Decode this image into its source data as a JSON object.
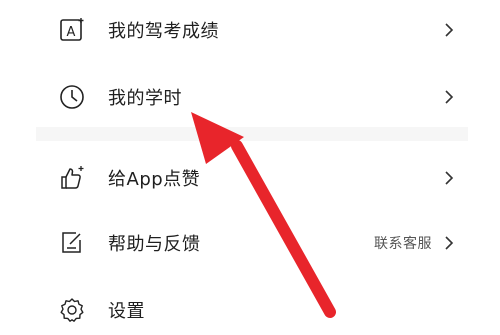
{
  "menu": {
    "items": [
      {
        "label": "我的驾考成绩",
        "icon": "exam-score-icon"
      },
      {
        "label": "我的学时",
        "icon": "clock-icon"
      },
      {
        "label": "给App点赞",
        "icon": "thumbs-up-icon"
      },
      {
        "label": "帮助与反馈",
        "icon": "feedback-edit-icon",
        "hint": "联系客服"
      },
      {
        "label": "设置",
        "icon": "gear-icon"
      }
    ]
  },
  "annotation": {
    "color": "#e8252b",
    "icon": "red-arrow-icon"
  }
}
